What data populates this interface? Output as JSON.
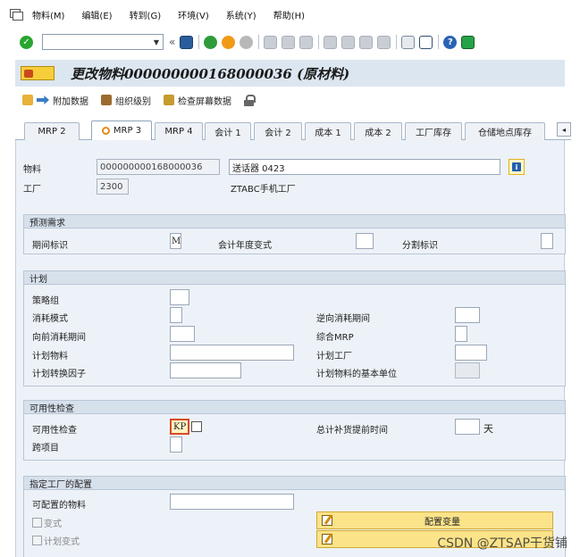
{
  "menu": {
    "items": [
      "物料(M)",
      "编辑(E)",
      "转到(G)",
      "环境(V)",
      "系统(Y)",
      "帮助(H)"
    ]
  },
  "toolbar": {
    "command_value": "",
    "icons": [
      "enter-icon",
      "save-icon",
      "back-icon",
      "exit-icon",
      "cancel-icon",
      "print-icon",
      "find-icon",
      "find-next-icon",
      "first-page-icon",
      "prev-page-icon",
      "next-page-icon",
      "last-page-icon",
      "create-session-icon",
      "shortcut-icon",
      "help-icon",
      "customize-layout-icon"
    ]
  },
  "title": "更改物料000000000168000036 (原材料)",
  "app_toolbar": {
    "additional_data": "附加数据",
    "org_levels": "组织级别",
    "check_screen_data": "检查屏幕数据"
  },
  "tabs": [
    "MRP 2",
    "MRP 3",
    "MRP 4",
    "会计 1",
    "会计 2",
    "成本 1",
    "成本 2",
    "工厂库存",
    "仓储地点库存"
  ],
  "active_tab": "MRP 3",
  "header": {
    "material_label": "物料",
    "material_value": "000000000168000036",
    "material_desc": "送话器 0423",
    "plant_label": "工厂",
    "plant_value": "2300",
    "plant_desc": "ZTABC手机工厂"
  },
  "forecast": {
    "title": "预测需求",
    "period_indicator_label": "期间标识",
    "period_indicator_value": "M",
    "fiscal_year_variant_label": "会计年度变式",
    "fiscal_year_variant_value": "",
    "splitting_indicator_label": "分割标识",
    "splitting_indicator_value": ""
  },
  "planning": {
    "title": "计划",
    "strategy_group_label": "策略组",
    "consumption_mode_label": "消耗模式",
    "bwd_consumption_label": "逆向消耗期间",
    "fwd_consumption_label": "向前消耗期间",
    "mixed_mrp_label": "综合MRP",
    "planning_material_label": "计划物料",
    "planning_plant_label": "计划工厂",
    "conv_factor_label": "计划转换因子",
    "planning_base_unit_label": "计划物料的基本单位"
  },
  "availability": {
    "title": "可用性检查",
    "check_label": "可用性检查",
    "check_value": "KP",
    "total_repl_lead_time_label": "总计补货提前时间",
    "total_repl_lead_time_value": "",
    "unit": "天",
    "cross_project_label": "跨项目"
  },
  "plant_config": {
    "title": "指定工厂的配置",
    "configurable_material_label": "可配置的物料",
    "variant_label": "变式",
    "planning_variant_label": "计划变式",
    "configure_variant_button": "配置变量",
    "second_button": ""
  },
  "watermark": "CSDN @ZTSAP干货铺"
}
